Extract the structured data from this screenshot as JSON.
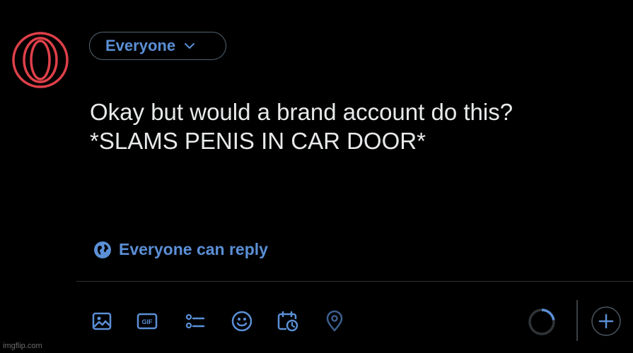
{
  "composer": {
    "audience_label": "Everyone",
    "text_lines": [
      "Okay but would a brand account do this?",
      "*SLAMS PENIS IN CAR DOOR*"
    ],
    "reply_setting_label": "Everyone can reply",
    "avatar_icon": "opera-logo-icon"
  },
  "toolbar": {
    "icons": [
      "image-icon",
      "gif-icon",
      "poll-icon",
      "emoji-icon",
      "schedule-icon",
      "location-icon"
    ],
    "gif_label": "GIF",
    "progress_icon": "character-progress-ring",
    "add_icon": "add-post-icon"
  },
  "watermark": "imgflip.com",
  "colors": {
    "background": "#000000",
    "text": "#e7e9ea",
    "accent": "#5b8fd6",
    "avatar_red": "#e0404a",
    "divider": "#2f3336"
  }
}
